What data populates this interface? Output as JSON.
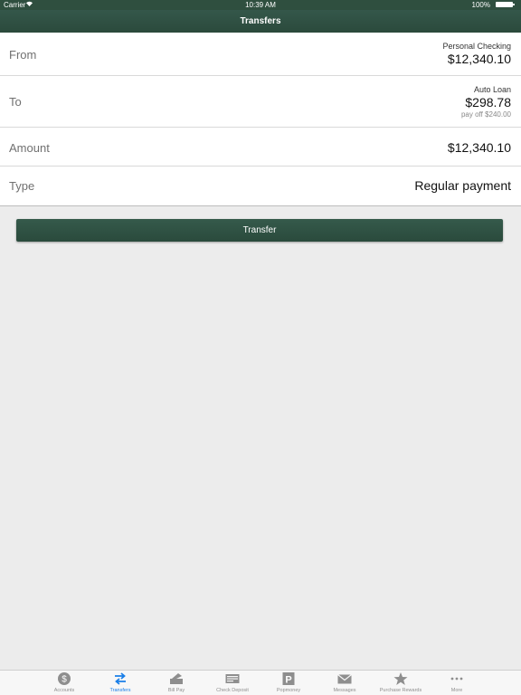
{
  "status_bar": {
    "carrier": "Carrier",
    "wifi_icon": "wifi-icon",
    "time": "10:39 AM",
    "battery": "100%"
  },
  "nav": {
    "title": "Transfers"
  },
  "form": {
    "from": {
      "label": "From",
      "account_name": "Personal Checking",
      "amount": "$12,340.10"
    },
    "to": {
      "label": "To",
      "account_name": "Auto Loan",
      "amount": "$298.78",
      "sub": "pay off $240.00"
    },
    "amount": {
      "label": "Amount",
      "value": "$12,340.10"
    },
    "type": {
      "label": "Type",
      "value": "Regular payment"
    }
  },
  "transfer_button": {
    "label": "Transfer"
  },
  "tabbar": {
    "accent_color": "#1a7fe8",
    "inactive_color": "#8e8e8e",
    "items": [
      {
        "label": "Accounts",
        "icon": "dollar-circle-icon"
      },
      {
        "label": "Transfers",
        "icon": "transfer-arrows-icon",
        "active": true
      },
      {
        "label": "Bill Pay",
        "icon": "bill-pay-icon"
      },
      {
        "label": "Check Deposit",
        "icon": "check-deposit-icon"
      },
      {
        "label": "Popmoney",
        "icon": "popmoney-icon"
      },
      {
        "label": "Messages",
        "icon": "envelope-icon"
      },
      {
        "label": "Purchase Rewards",
        "icon": "star-icon"
      },
      {
        "label": "More",
        "icon": "ellipsis-icon"
      }
    ]
  },
  "colors": {
    "header_green": "#2f4f3f",
    "background": "#ececec"
  }
}
